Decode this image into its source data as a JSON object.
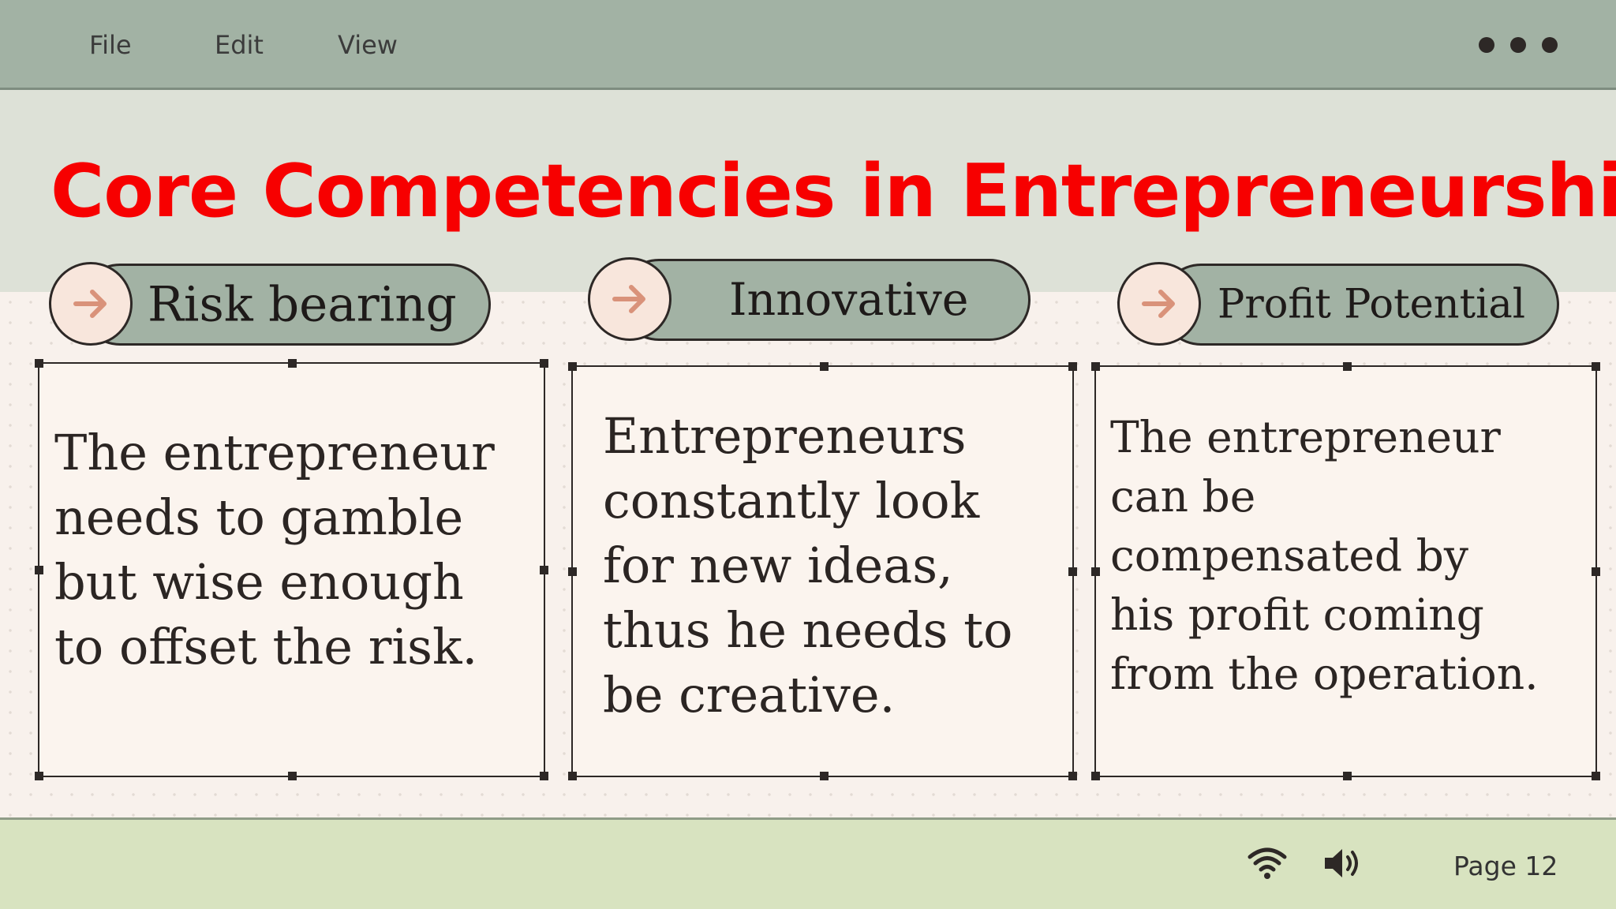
{
  "menu": {
    "items": [
      "File",
      "Edit",
      "View"
    ]
  },
  "slide": {
    "title": "Core Competencies in Entrepreneurship",
    "cards": [
      {
        "label": "Risk bearing",
        "body": "The entrepreneur\nneeds to gamble\nbut wise enough\nto offset the risk."
      },
      {
        "label": "Innovative",
        "body": "Entrepreneurs\nconstantly look\nfor new ideas,\nthus he needs to\nbe creative."
      },
      {
        "label": "Profit Potential",
        "body": "The entrepreneur\ncan be\ncompensated by\nhis profit coming\nfrom the operation."
      }
    ]
  },
  "statusbar": {
    "page": "Page 12"
  },
  "icons": {
    "more": "more-dots-icon",
    "arrow": "arrow-right-icon",
    "wifi": "wifi-icon",
    "volume": "volume-icon"
  },
  "colors": {
    "menubar": "#a2b2a4",
    "title_band": "#dde1d7",
    "title_text": "#f70000",
    "pill": "#a2b2a4",
    "arrow": "#d9927a",
    "statusbar": "#d8e3c0"
  }
}
